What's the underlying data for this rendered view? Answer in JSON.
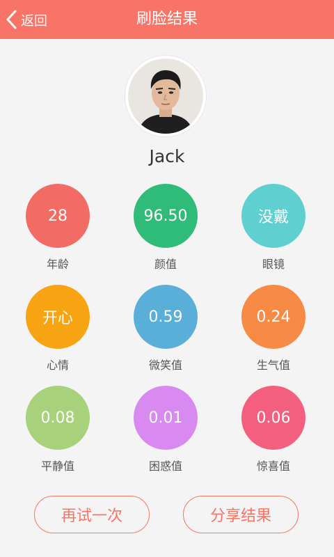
{
  "header": {
    "back_label": "返回",
    "title": "刷脸结果"
  },
  "profile": {
    "name": "Jack"
  },
  "results": [
    {
      "value": "28",
      "label": "年龄",
      "color": "#f26b64"
    },
    {
      "value": "96.50",
      "label": "颜值",
      "color": "#2fbb78"
    },
    {
      "value": "没戴",
      "label": "眼镜",
      "color": "#5fcfcf"
    },
    {
      "value": "开心",
      "label": "心情",
      "color": "#f8a312"
    },
    {
      "value": "0.59",
      "label": "微笑值",
      "color": "#5aafd8"
    },
    {
      "value": "0.24",
      "label": "生气值",
      "color": "#f78a45"
    },
    {
      "value": "0.08",
      "label": "平静值",
      "color": "#a7d17a"
    },
    {
      "value": "0.01",
      "label": "困惑值",
      "color": "#d88af0"
    },
    {
      "value": "0.06",
      "label": "惊喜值",
      "color": "#f45f80"
    }
  ],
  "buttons": {
    "retry_label": "再试一次",
    "share_label": "分享结果"
  },
  "theme": {
    "accent": "#f77466",
    "background": "#f4f4f4"
  }
}
